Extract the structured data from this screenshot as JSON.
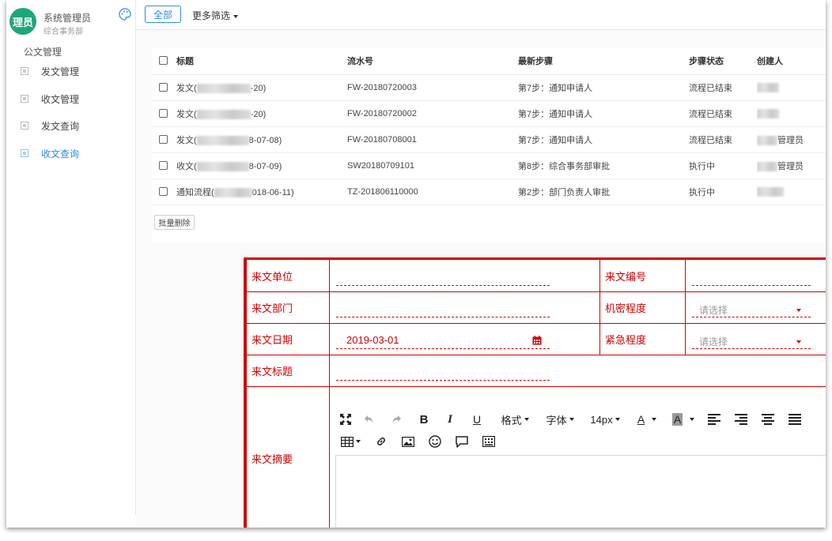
{
  "sidebar": {
    "avatar_text": "理员",
    "user_name": "系统管理员",
    "user_dept": "综合事务部",
    "group_label": "公文管理",
    "items": [
      {
        "label": "发文管理",
        "active": false
      },
      {
        "label": "收文管理",
        "active": false
      },
      {
        "label": "发文查询",
        "active": false
      },
      {
        "label": "收文查询",
        "active": true
      }
    ]
  },
  "toolbar": {
    "all_label": "全部",
    "more_filter_label": "更多筛选"
  },
  "table": {
    "headers": [
      "标题",
      "流水号",
      "最新步骤",
      "步骤状态",
      "创建人"
    ],
    "rows": [
      {
        "title_prefix": "发文(",
        "title_suffix": "-20)",
        "serial": "FW-20180720003",
        "step": "第7步：通知申请人",
        "status": "流程已结束",
        "creator_suffix": ""
      },
      {
        "title_prefix": "发文(",
        "title_suffix": "-20)",
        "serial": "FW-20180720002",
        "step": "第7步：通知申请人",
        "status": "流程已结束",
        "creator_suffix": ""
      },
      {
        "title_prefix": "发文(",
        "title_suffix": "8-07-08)",
        "serial": "FW-20180708001",
        "step": "第7步：通知申请人",
        "status": "流程已结束",
        "creator_suffix": "管理员"
      },
      {
        "title_prefix": "收文(",
        "title_suffix": "8-07-09)",
        "serial": "SW20180709101",
        "step": "第8步：综合事务部审批",
        "status": "执行中",
        "creator_suffix": "管理员"
      },
      {
        "title_prefix": "通知流程(",
        "title_suffix": "018-06-11)",
        "serial": "TZ-201806110000",
        "step": "第2步：部门负责人审批",
        "status": "执行中",
        "creator_suffix": ""
      }
    ],
    "serial_colors": [
      "#e43a3a",
      "#e43a3a",
      "#e43a3a",
      "#e43a3a",
      "#555555"
    ],
    "batch_delete_label": "批量删除"
  },
  "form": {
    "labels": {
      "unit": "来文单位",
      "number": "来文编号",
      "dept": "来文部门",
      "secrecy": "机密程度",
      "date": "来文日期",
      "urgency": "紧急程度",
      "subject": "来文标题",
      "abstract": "来文摘要"
    },
    "date_value": "2019-03-01",
    "secrecy_placeholder": "请选择",
    "urgency_placeholder": "请选择"
  },
  "editor": {
    "format_label": "格式",
    "font_label": "字体",
    "size_label": "14px",
    "icons": [
      "fullscreen-icon",
      "undo-icon",
      "redo-icon",
      "bold-icon",
      "italic-icon",
      "underline-icon",
      "font-color-icon",
      "bg-color-icon",
      "align-left-icon",
      "align-right-icon",
      "align-center-icon",
      "align-justify-icon",
      "table-icon",
      "link-icon",
      "image-icon",
      "emoji-icon",
      "comment-icon",
      "special-chars-icon"
    ]
  },
  "colors": {
    "accent": "#2d8cf0",
    "avatar": "#1ea67a",
    "form_red": "#d40000",
    "serial_red": "#e43a3a"
  }
}
